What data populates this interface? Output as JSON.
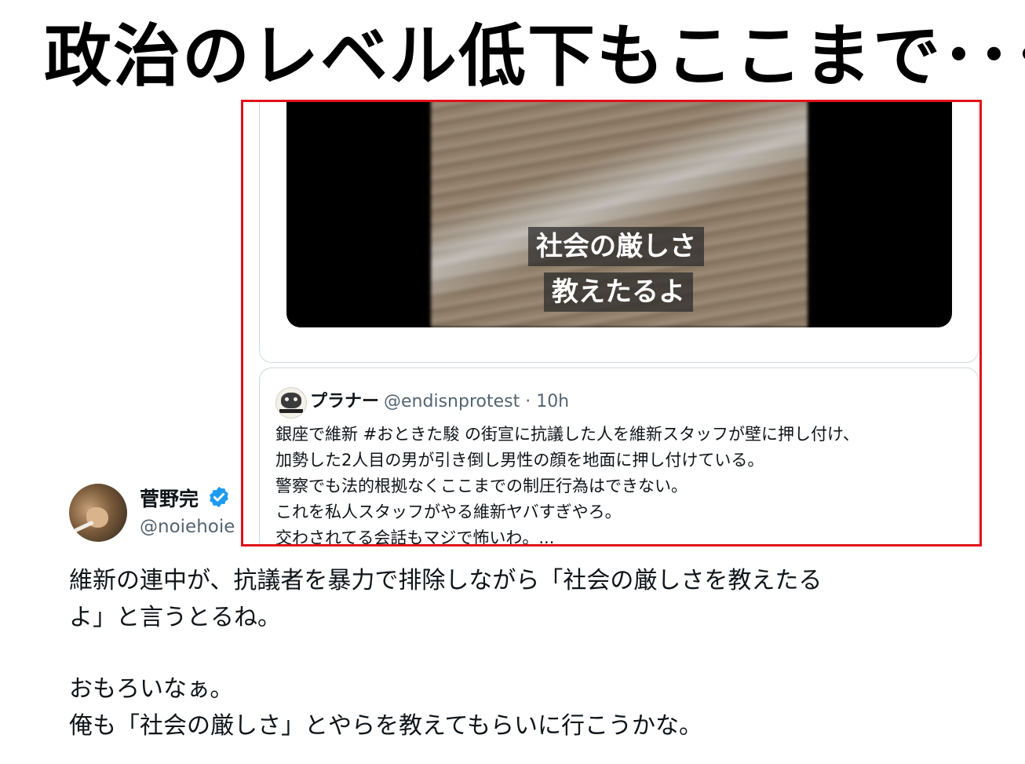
{
  "headline": "政治のレベル低下もここまで･･･",
  "tweet": {
    "author_name": "菅野完",
    "author_handle": "@noiehoie",
    "verified_color": "#1d9bf0",
    "body": [
      "維新の連中が、抗議者を暴力で排除しながら「社会の厳しさを教えたる",
      "よ」と言うとるね。",
      "",
      "おもろいなぁ。",
      "俺も「社会の厳しさ」とやらを教えてもらいに行こうかな。"
    ]
  },
  "overlay": {
    "border_color": "#e0111a",
    "video_subtitles": [
      "社会の厳しさ",
      "教えたるよ"
    ],
    "quoted": {
      "name": "プラナー",
      "meta": "@endisnprotest · 10h",
      "lines": [
        "銀座で維新 #おときた駿 の街宣に抗議した人を維新スタッフが壁に押し付け、",
        "加勢した2人目の男が引き倒し男性の顔を地面に押し付けている。",
        "警察でも法的根拠なくここまでの制圧行為はできない。",
        "これを私人スタッフがやる維新ヤバすぎやろ。",
        "交わされてる会話もマジで怖いわ。..."
      ]
    }
  }
}
